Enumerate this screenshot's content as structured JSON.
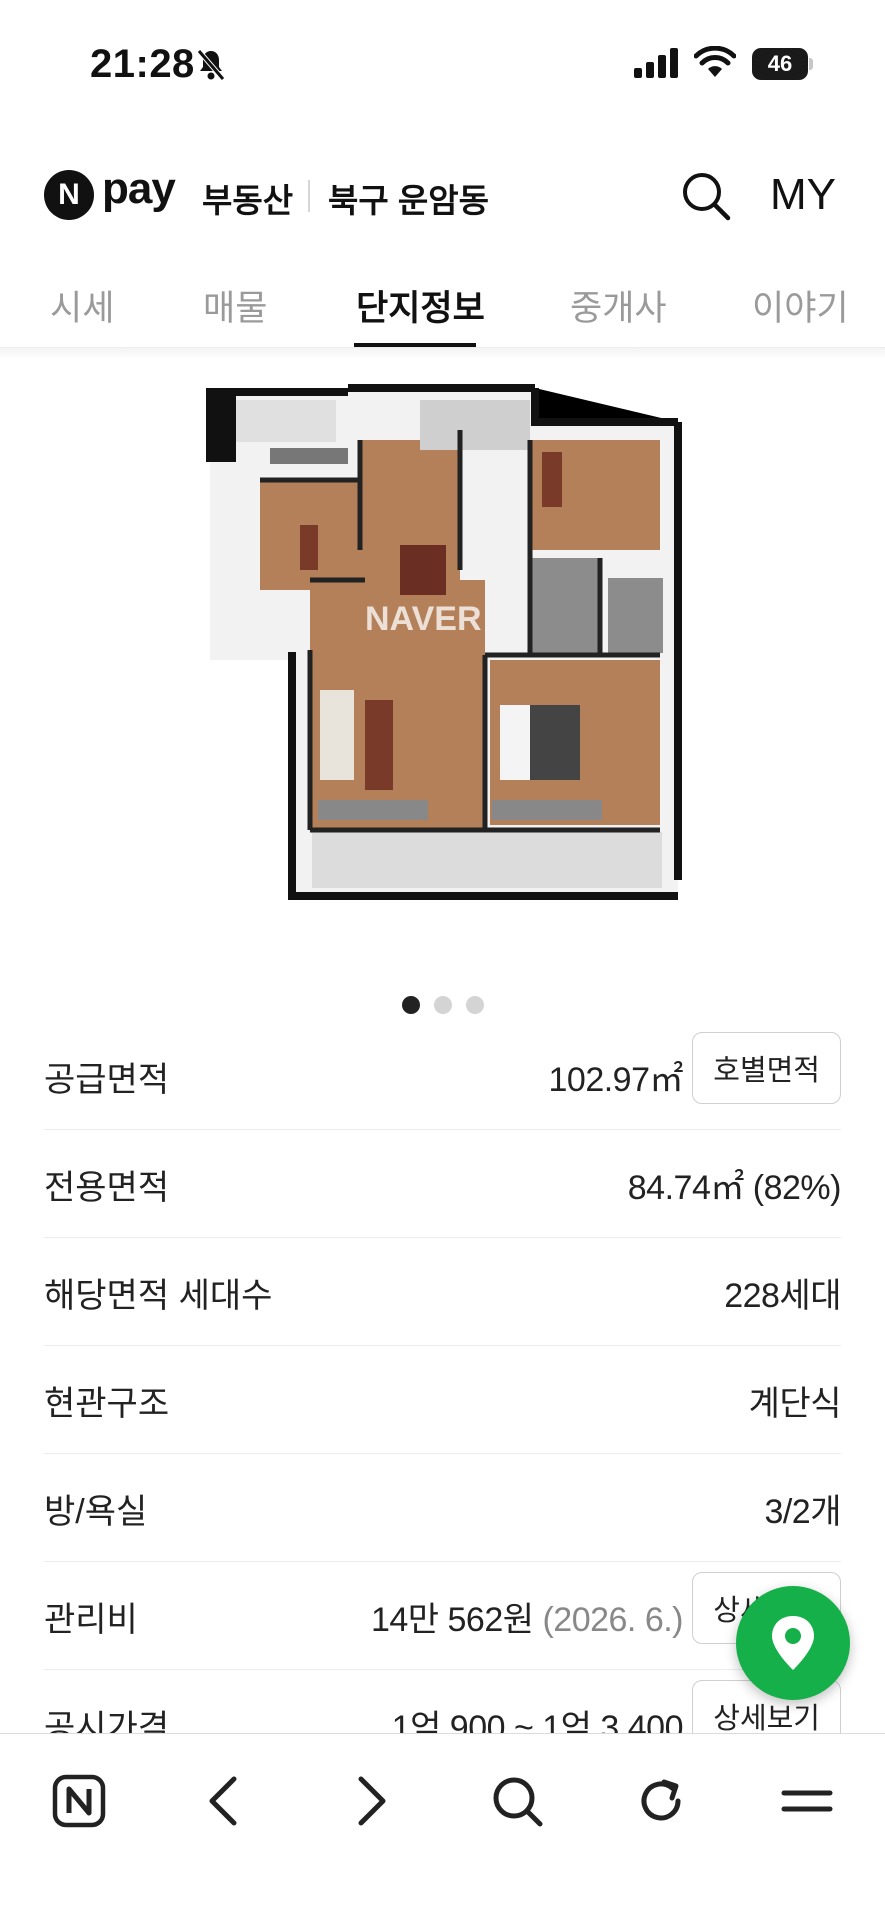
{
  "status_bar": {
    "time": "21:28",
    "battery": "46"
  },
  "header": {
    "logo_letter": "N",
    "pay": "pay",
    "service": "부동산",
    "region": "북구 운암동",
    "my": "MY"
  },
  "tabs": [
    {
      "label": "시세"
    },
    {
      "label": "매물"
    },
    {
      "label": "단지정보"
    },
    {
      "label": "중개사"
    },
    {
      "label": "이야기"
    }
  ],
  "active_tab": "단지정보",
  "floorplan": {
    "watermark": "NAVER",
    "carousel_total": 3,
    "carousel_active": 1
  },
  "rows": [
    {
      "label": "공급면적",
      "value": "102.97㎡",
      "button": "호별면적"
    },
    {
      "label": "전용면적",
      "value": "84.74㎡ (82%)"
    },
    {
      "label": "해당면적 세대수",
      "value": "228세대"
    },
    {
      "label": "현관구조",
      "value": "계단식"
    },
    {
      "label": "방/욕실",
      "value": "3/2개"
    },
    {
      "label": "관리비",
      "value": "14만 562원",
      "value_note": "(2026. 6.)",
      "button": "상세보기"
    },
    {
      "label": "공시가격",
      "value": "1억 900 ~ 1억 3,400",
      "button": "상세보기"
    }
  ],
  "colors": {
    "accent_green": "#15b04a",
    "text_dark": "#111111",
    "tab_inactive": "#9a9a9a"
  }
}
